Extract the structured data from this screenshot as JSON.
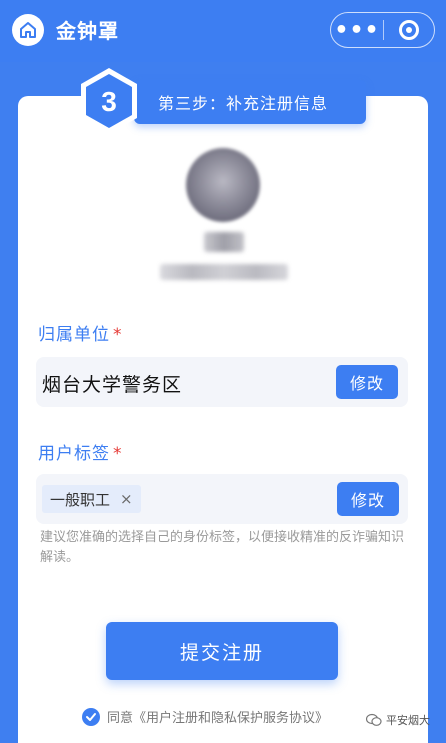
{
  "header": {
    "title": "金钟罩",
    "more_label": "•••",
    "icons": [
      "home-icon",
      "more-icon",
      "target-close-icon"
    ]
  },
  "step": {
    "number": "3",
    "label": "第三步：补充注册信息"
  },
  "form": {
    "unit": {
      "label": "归属单位",
      "required_mark": "*",
      "value": "烟台大学警务区",
      "edit_label": "修改"
    },
    "tag": {
      "label": "用户标签",
      "required_mark": "*",
      "chip": "一般职工",
      "chip_remove": "×",
      "edit_label": "修改",
      "hint": "建议您准确的选择自己的身份标签，以便接收精准的反诈骗知识解读。"
    }
  },
  "submit_label": "提交注册",
  "agreement": {
    "checked": true,
    "text": "同意《用户注册和隐私保护服务协议》"
  },
  "watermark": "平安烟大",
  "colors": {
    "primary": "#3d7ef2",
    "required": "#e53935",
    "field_bg": "#f3f5fa"
  }
}
